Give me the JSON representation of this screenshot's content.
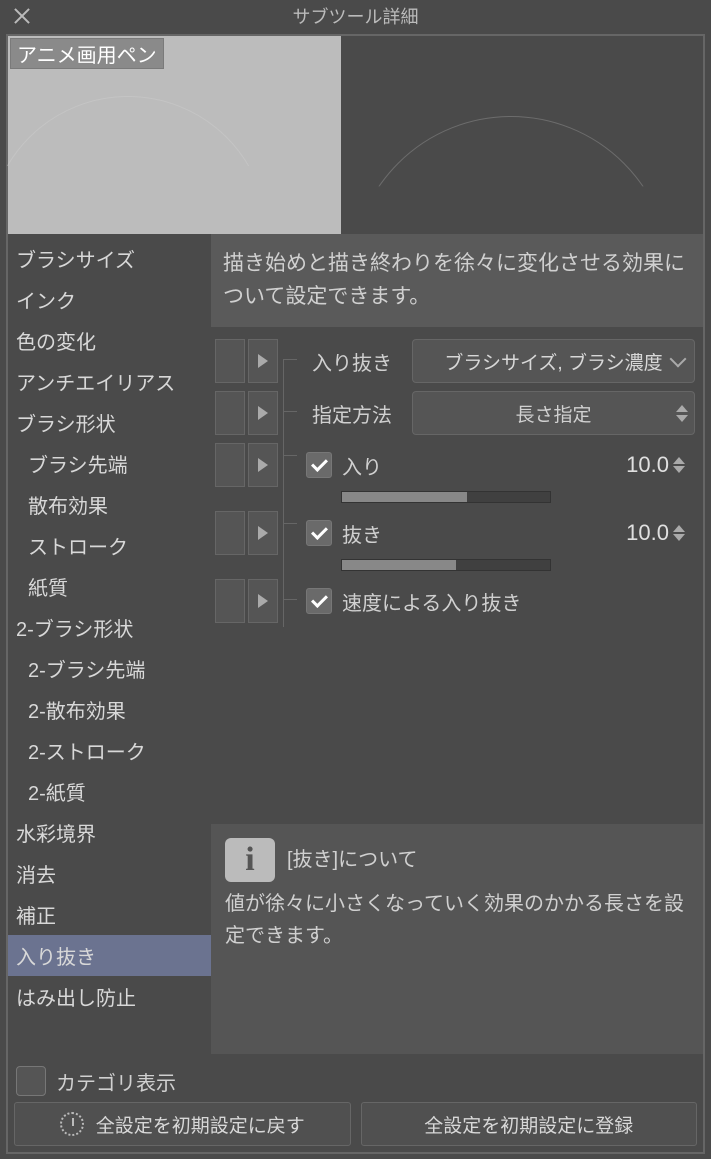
{
  "title": "サブツール詳細",
  "tool_name": "アニメ画用ペン",
  "sidebar": {
    "items": [
      {
        "label": "ブラシサイズ"
      },
      {
        "label": "インク"
      },
      {
        "label": "色の変化"
      },
      {
        "label": "アンチエイリアス"
      },
      {
        "label": "ブラシ形状"
      },
      {
        "label": "ブラシ先端"
      },
      {
        "label": "散布効果"
      },
      {
        "label": "ストローク"
      },
      {
        "label": "紙質"
      },
      {
        "label": "2-ブラシ形状"
      },
      {
        "label": "2-ブラシ先端"
      },
      {
        "label": "2-散布効果"
      },
      {
        "label": "2-ストローク"
      },
      {
        "label": "2-紙質"
      },
      {
        "label": "水彩境界"
      },
      {
        "label": "消去"
      },
      {
        "label": "補正"
      },
      {
        "label": "入り抜き"
      },
      {
        "label": "はみ出し防止"
      }
    ],
    "selected_index": 17
  },
  "description": "描き始めと描き終わりを徐々に変化させる効果について設定できます。",
  "controls": {
    "iri_nuki": {
      "label": "入り抜き",
      "value": "ブラシサイズ, ブラシ濃度"
    },
    "method": {
      "label": "指定方法",
      "value": "長さ指定"
    },
    "iri": {
      "label": "入り",
      "checked": true,
      "value": "10.0"
    },
    "nuki": {
      "label": "抜き",
      "checked": true,
      "value": "10.0"
    },
    "speed": {
      "label": "速度による入り抜き",
      "checked": true
    }
  },
  "info": {
    "title": "[抜き]について",
    "body": "値が徐々に小さくなっていく効果のかかる長さを設定できます。"
  },
  "footer": {
    "category_label": "カテゴリ表示",
    "reset_label": "全設定を初期設定に戻す",
    "register_label": "全設定を初期設定に登録"
  }
}
